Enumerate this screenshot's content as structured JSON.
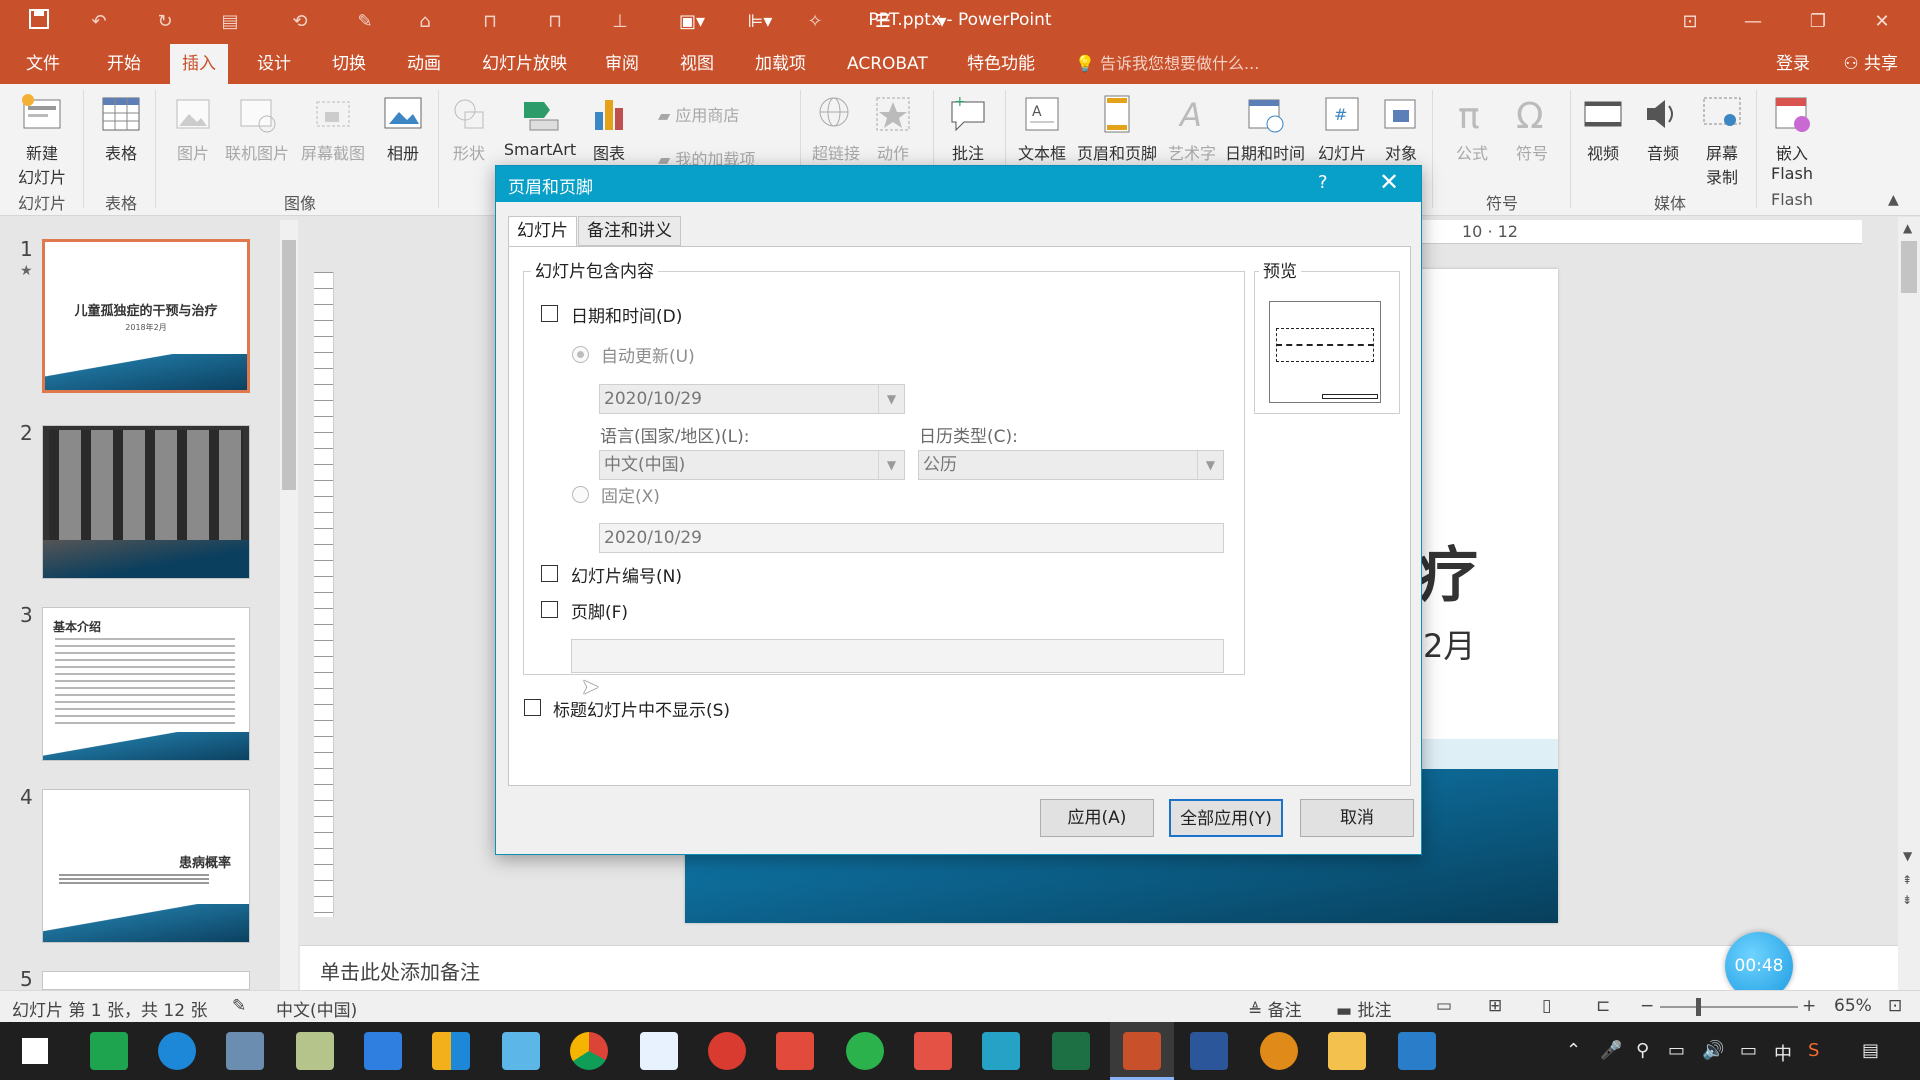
{
  "window": {
    "title": "PPT.pptx - PowerPoint"
  },
  "tabs": [
    "文件",
    "开始",
    "插入",
    "设计",
    "切换",
    "动画",
    "幻灯片放映",
    "审阅",
    "视图",
    "加载项",
    "ACROBAT",
    "特色功能"
  ],
  "active_tab": "插入",
  "tell_me": "告诉我您想要做什么...",
  "account": {
    "login": "登录",
    "share": "共享"
  },
  "ribbon": {
    "new_slide": "新建\n幻灯片",
    "table": "表格",
    "picture": "图片",
    "online_picture": "联机图片",
    "screenshot": "屏幕截图",
    "album": "相册",
    "shapes": "形状",
    "smartart": "SmartArt",
    "chart": "图表",
    "store": "应用商店",
    "my_addins": "我的加载项",
    "hyperlink": "超链接",
    "action": "动作",
    "comment": "批注",
    "textbox": "文本框",
    "header_footer": "页眉和页脚",
    "wordart": "艺术字",
    "datetime": "日期和时间",
    "slide_number": "幻灯片",
    "object": "对象",
    "equation": "公式",
    "symbol": "符号",
    "video": "视频",
    "audio": "音频",
    "screen_record": "屏幕\n录制",
    "embed_flash": "嵌入\nFlash",
    "groups": {
      "slides": "幻灯片",
      "tables": "表格",
      "images": "图像",
      "symbols": "符号",
      "media": "媒体",
      "flash": "Flash"
    }
  },
  "thumbnails": [
    {
      "num": "1",
      "title": "儿童孤独症的干预与治疗",
      "sub": "2018年2月"
    },
    {
      "num": "2"
    },
    {
      "num": "3",
      "title": "基本介绍"
    },
    {
      "num": "4",
      "title": "患病概率"
    },
    {
      "num": "5"
    }
  ],
  "slide_preview": {
    "title_fragment": "疗",
    "sub_fragment": "2月"
  },
  "ruler": {
    "top_marks": "10 · 12"
  },
  "notes_placeholder": "单击此处添加备注",
  "status": {
    "slide_info": "幻灯片 第 1 张，共 12 张",
    "language": "中文(中国)",
    "notes": "备注",
    "comments": "批注",
    "zoom": "65%"
  },
  "recording_timer": "00:48",
  "dialog": {
    "title": "页眉和页脚",
    "help": "?",
    "tabs": [
      "幻灯片",
      "备注和讲义"
    ],
    "group_label": "幻灯片包含内容",
    "datetime_label": "日期和时间(D)",
    "auto_update_label": "自动更新(U)",
    "auto_date": "2020/10/29",
    "language_label": "语言(国家/地区)(L):",
    "language_value": "中文(中国)",
    "calendar_label": "日历类型(C):",
    "calendar_value": "公历",
    "fixed_label": "固定(X)",
    "fixed_date": "2020/10/29",
    "slide_number_label": "幻灯片编号(N)",
    "footer_label": "页脚(F)",
    "footer_value": "",
    "hide_on_title_label": "标题幻灯片中不显示(S)",
    "preview_label": "预览",
    "apply": "应用(A)",
    "apply_all": "全部应用(Y)",
    "cancel": "取消"
  }
}
